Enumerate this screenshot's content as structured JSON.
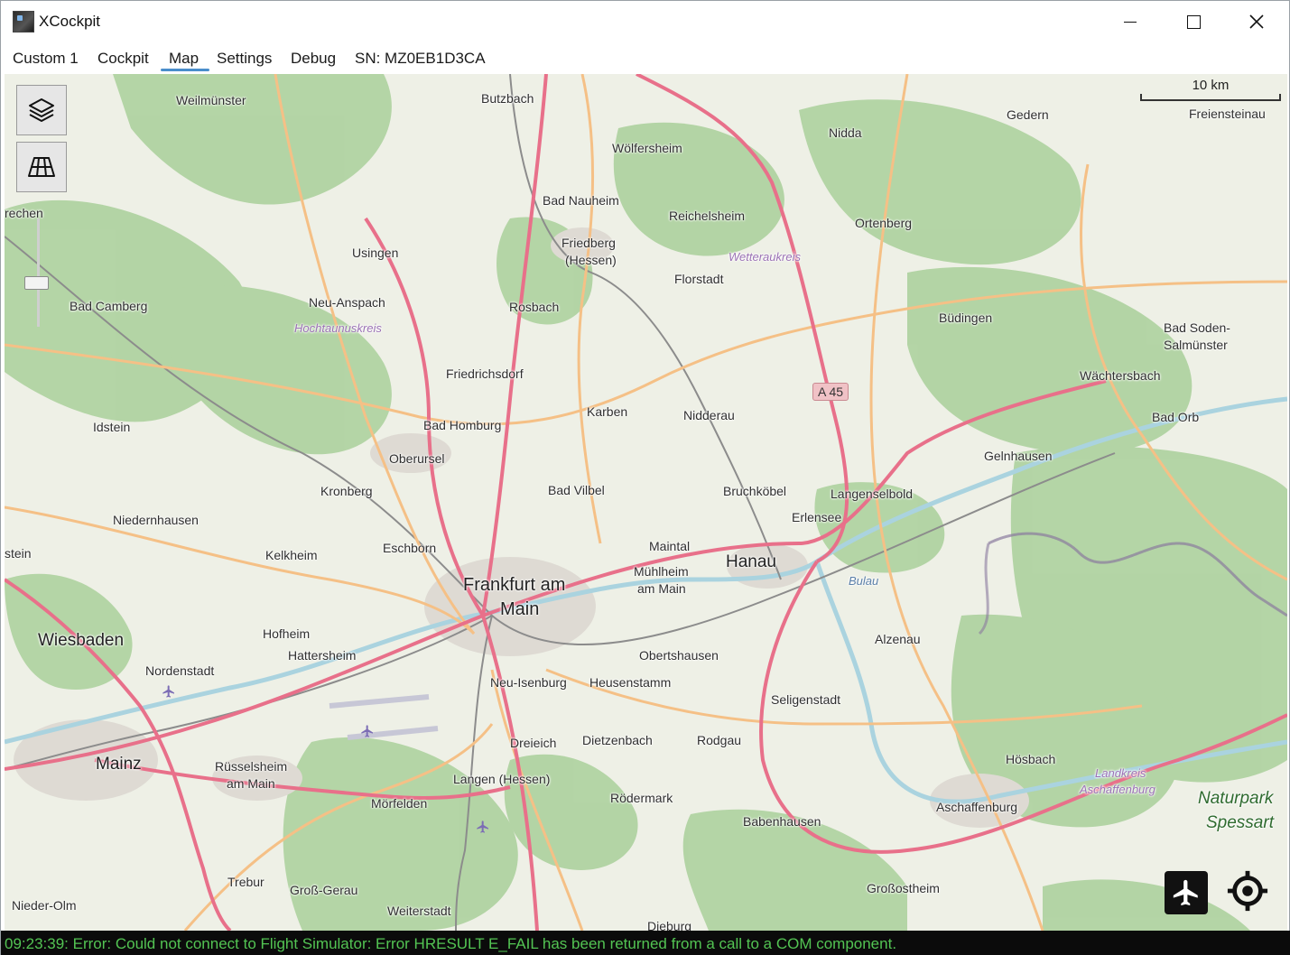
{
  "window": {
    "title": "XCockpit",
    "minimize_icon": "minimize-icon",
    "maximize_icon": "maximize-icon",
    "close_icon": "close-icon"
  },
  "menu": {
    "items": [
      {
        "label": "Custom 1"
      },
      {
        "label": "Cockpit"
      },
      {
        "label": "Map",
        "active": true
      },
      {
        "label": "Settings"
      },
      {
        "label": "Debug"
      },
      {
        "label": "SN: MZ0EB1D3CA"
      }
    ]
  },
  "map": {
    "scale_label": "10 km",
    "road_shield": "A 45",
    "controls": {
      "layers_icon": "layers-icon",
      "grid_icon": "grid-icon",
      "plane_icon": "airplane-icon",
      "locate_icon": "crosshair-icon"
    },
    "places": [
      {
        "name": "Wiesbaden",
        "size": "big"
      },
      {
        "name": "Mainz",
        "size": "big"
      },
      {
        "name": "Hanau",
        "size": "big"
      },
      {
        "name": "Frankfurt am",
        "size": "big2"
      },
      {
        "name": "Main",
        "size": "big2"
      },
      {
        "name": "Weilmünster"
      },
      {
        "name": "Butzbach"
      },
      {
        "name": "Gedern"
      },
      {
        "name": "Freiensteinau"
      },
      {
        "name": "Nidda"
      },
      {
        "name": "Wölfersheim"
      },
      {
        "name": "Bad Nauheim"
      },
      {
        "name": "Reichelsheim"
      },
      {
        "name": "Ortenberg"
      },
      {
        "name": "Friedberg"
      },
      {
        "name": "(Hessen)"
      },
      {
        "name": "Usingen"
      },
      {
        "name": "Florstadt"
      },
      {
        "name": "Bad Camberg"
      },
      {
        "name": "Neu-Anspach"
      },
      {
        "name": "Rosbach"
      },
      {
        "name": "Büdingen"
      },
      {
        "name": "Bad Soden-"
      },
      {
        "name": "Salmünster"
      },
      {
        "name": "Friedrichsdorf"
      },
      {
        "name": "Wächtersbach"
      },
      {
        "name": "Karben"
      },
      {
        "name": "Nidderau"
      },
      {
        "name": "Idstein"
      },
      {
        "name": "Bad Homburg"
      },
      {
        "name": "Bad Orb"
      },
      {
        "name": "Gelnhausen"
      },
      {
        "name": "Oberursel"
      },
      {
        "name": "Bad Vilbel"
      },
      {
        "name": "Bruchköbel"
      },
      {
        "name": "Langenselbold"
      },
      {
        "name": "Kronberg"
      },
      {
        "name": "Erlensee"
      },
      {
        "name": "Niedernhausen"
      },
      {
        "name": "Maintal"
      },
      {
        "name": "Eschborn"
      },
      {
        "name": "Kelkheim"
      },
      {
        "name": "Mühlheim"
      },
      {
        "name": "am Main"
      },
      {
        "name": "Hofheim"
      },
      {
        "name": "Alzenau"
      },
      {
        "name": "Hattersheim"
      },
      {
        "name": "Obertshausen"
      },
      {
        "name": "Nordenstadt"
      },
      {
        "name": "Neu-Isenburg"
      },
      {
        "name": "Heusenstamm"
      },
      {
        "name": "Seligenstadt"
      },
      {
        "name": "Dreieich"
      },
      {
        "name": "Dietzenbach"
      },
      {
        "name": "Rodgau"
      },
      {
        "name": "Rüsselsheim"
      },
      {
        "name": "am Main"
      },
      {
        "name": "Hösbach"
      },
      {
        "name": "Langen (Hessen)"
      },
      {
        "name": "Mörfelden"
      },
      {
        "name": "Rödermark"
      },
      {
        "name": "Aschaffenburg"
      },
      {
        "name": "Babenhausen"
      },
      {
        "name": "Trebur"
      },
      {
        "name": "Groß-Gerau"
      },
      {
        "name": "Großostheim"
      },
      {
        "name": "Nieder-Olm"
      },
      {
        "name": "Weiterstadt"
      },
      {
        "name": "Dieburg"
      },
      {
        "name": "rechen"
      },
      {
        "name": "stein"
      }
    ],
    "regions": [
      "Hochtaunuskreis",
      "Wetteraukreis",
      "Landkreis",
      "Aschaffenburg"
    ],
    "water": [
      "Bulau"
    ],
    "nature": [
      "Naturpark",
      "Spessart"
    ],
    "colors": {
      "motorway": "#e8708a",
      "primary": "#f5c086",
      "forest": "#add19e",
      "water": "#aad3df",
      "rail": "#888888",
      "border": "#8a7a9e"
    }
  },
  "status": {
    "message": "09:23:39: Error: Could not connect to Flight Simulator: Error HRESULT E_FAIL has been returned from a call to a COM component.",
    "color": "#53c453"
  }
}
